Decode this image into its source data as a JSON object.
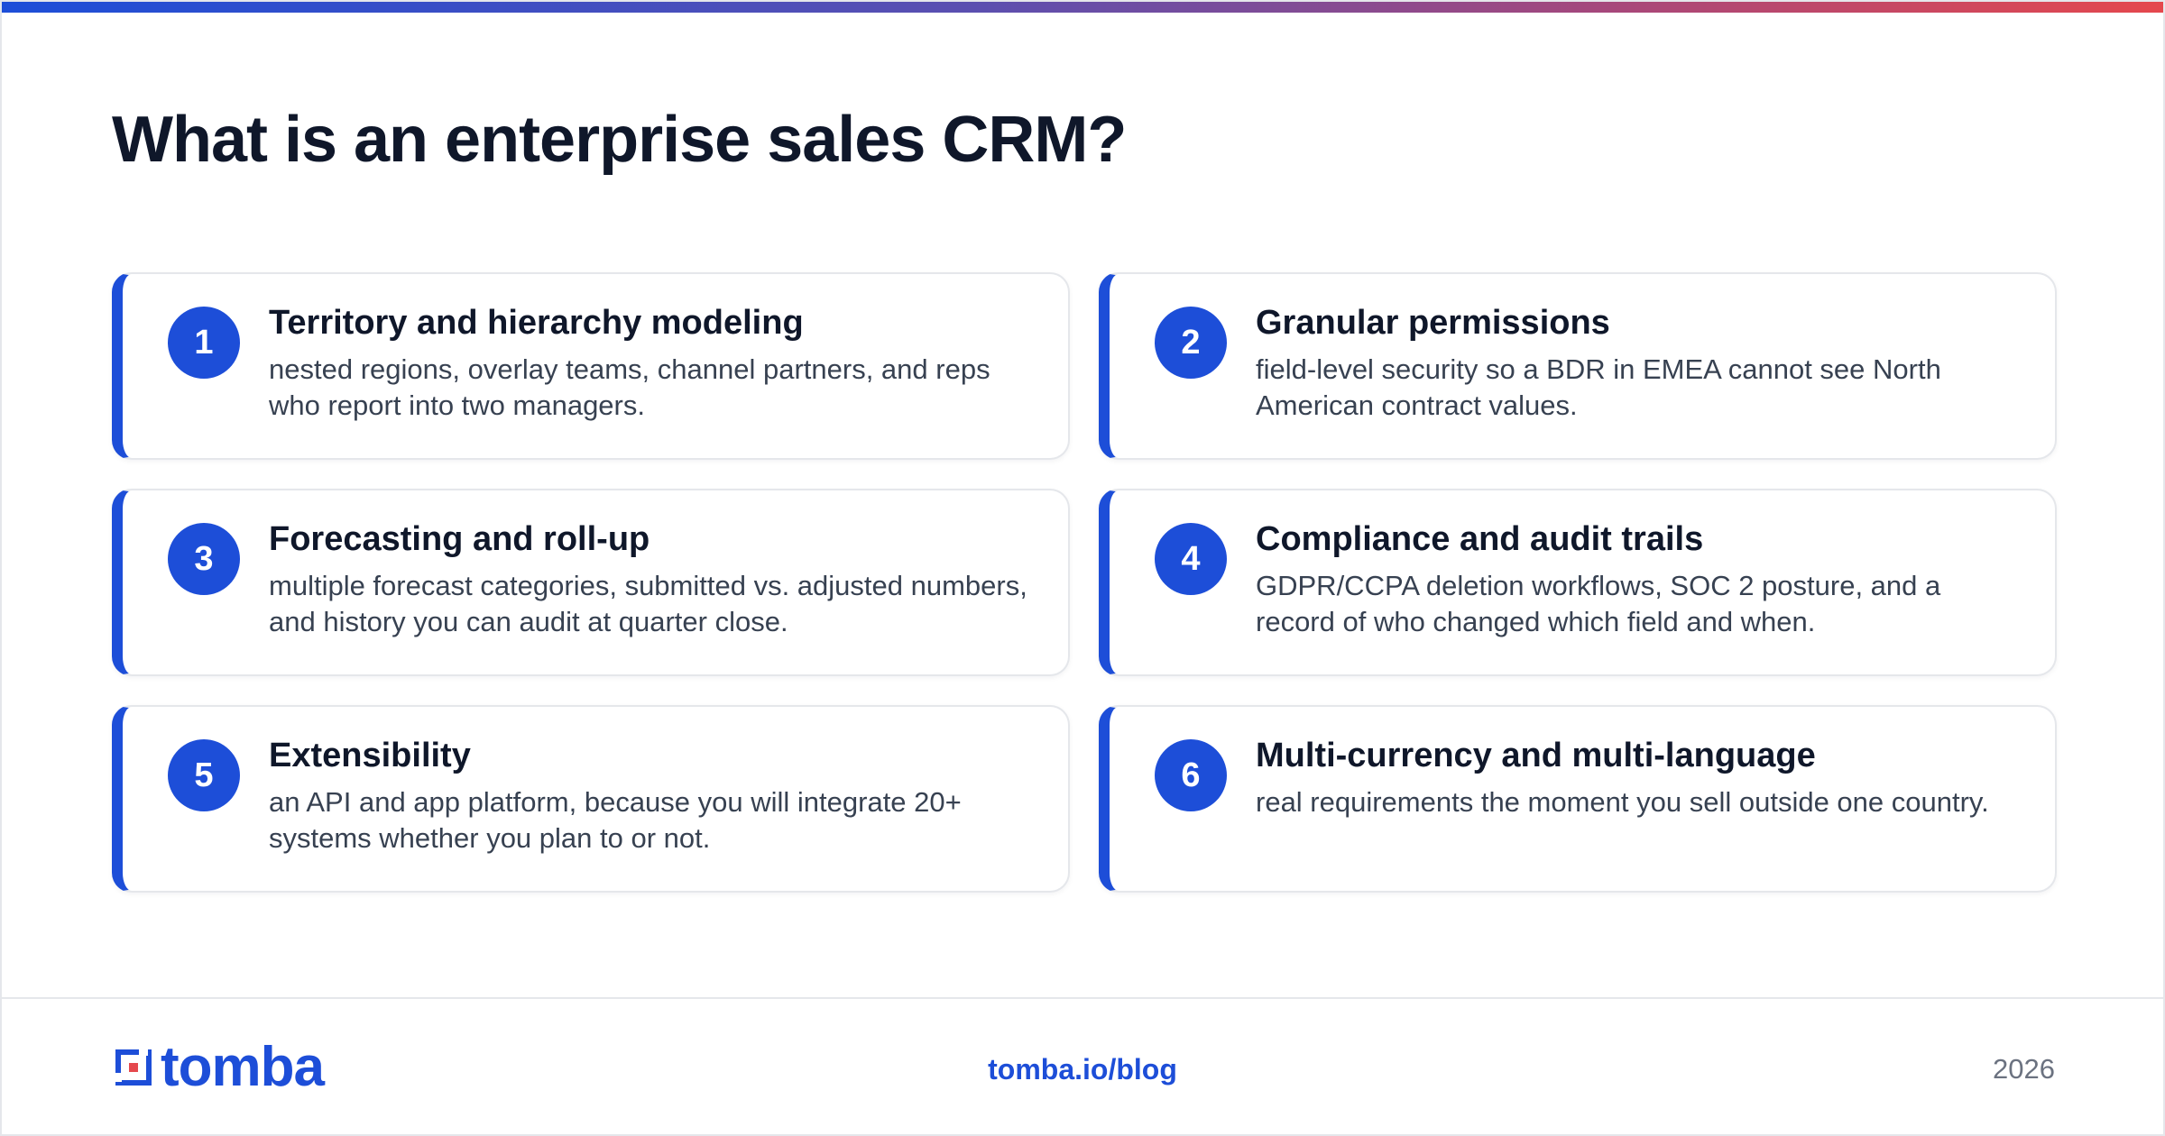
{
  "header": {
    "title": "What is an enterprise sales CRM?",
    "accent_gradient": [
      "#1d4ed8",
      "#5b4fb0",
      "#a8487a",
      "#e5484d"
    ]
  },
  "cards": [
    {
      "number": "1",
      "title": "Territory and hierarchy modeling",
      "description": "nested regions, overlay teams, channel partners, and reps who report into two managers."
    },
    {
      "number": "2",
      "title": "Granular permissions",
      "description": "field-level security so a BDR in EMEA cannot see North American contract values."
    },
    {
      "number": "3",
      "title": "Forecasting and roll-up",
      "description": "multiple forecast categories, submitted vs. adjusted numbers, and history you can audit at quarter close."
    },
    {
      "number": "4",
      "title": "Compliance and audit trails",
      "description": "GDPR/CCPA deletion workflows, SOC 2 posture, and a record of who changed which field and when."
    },
    {
      "number": "5",
      "title": "Extensibility",
      "description": "an API and app platform, because you will integrate 20+ systems whether you plan to or not."
    },
    {
      "number": "6",
      "title": "Multi-currency and multi-language",
      "description": "real requirements the moment you sell outside one country."
    }
  ],
  "footer": {
    "logo_text": "tomba",
    "logo_icon": "tomba-logo-mark-icon",
    "link_text": "tomba.io/blog",
    "year": "2026"
  },
  "colors": {
    "accent": "#1d4ed8",
    "title_text": "#0f172a",
    "body_text": "#374151",
    "muted_text": "#6b7280",
    "logo_red": "#e5484d"
  }
}
